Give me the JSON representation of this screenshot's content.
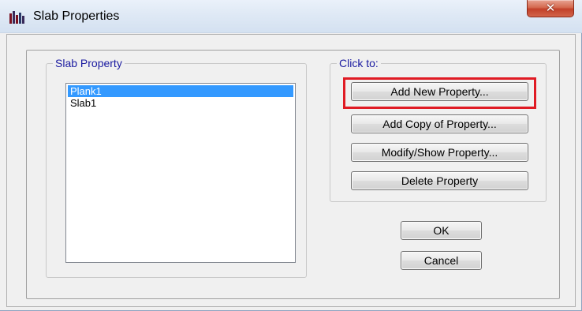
{
  "window": {
    "title": "Slab Properties",
    "close_glyph": "✕"
  },
  "slab_group": {
    "legend": "Slab Property",
    "items": [
      {
        "label": "Plank1",
        "selected": true
      },
      {
        "label": "Slab1",
        "selected": false
      }
    ]
  },
  "click_group": {
    "legend": "Click to:",
    "buttons": [
      {
        "label": "Add New Property..."
      },
      {
        "label": "Add Copy of Property..."
      },
      {
        "label": "Modify/Show Property..."
      },
      {
        "label": "Delete Property"
      }
    ]
  },
  "dialog_buttons": {
    "ok": "OK",
    "cancel": "Cancel"
  },
  "colors": {
    "selection": "#3399ff",
    "highlight": "#e01b24",
    "legend_text": "#1a1aa0"
  }
}
